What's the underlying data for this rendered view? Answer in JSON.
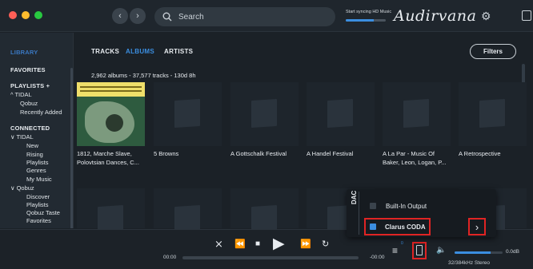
{
  "header": {
    "search_placeholder": "Search",
    "sync_label": "Start syncing HD Music",
    "sync_progress": 0.7,
    "logo": "Audirvana",
    "traffic_colors": [
      "#fe5f57",
      "#febc2e",
      "#28c840"
    ]
  },
  "sidebar": {
    "library": "LIBRARY",
    "favorites": "FAVORITES",
    "playlists": "PLAYLISTS  +",
    "playlist_items": [
      "^ TIDAL",
      "Qobuz",
      "Recently Added"
    ],
    "connected": "CONNECTED",
    "tidal_group": "∨ TIDAL",
    "tidal_items": [
      "New",
      "Rising",
      "Playlists",
      "Genres",
      "My Music"
    ],
    "qobuz_group": "∨ Qobuz",
    "qobuz_items": [
      "Discover",
      "Playlists",
      "Qobuz Taste",
      "Favorites"
    ]
  },
  "main": {
    "tabs": [
      "TRACKS",
      "ALBUMS",
      "ARTISTS"
    ],
    "active_tab": "ALBUMS",
    "filters_label": "Filters",
    "summary": "2,962 albums - 37,577 tracks - 130d 8h",
    "albums_row1": [
      {
        "title": "1812, Marche Slave,",
        "subtitle": "Polovtsian Dances, C..."
      },
      {
        "title": "5 Browns",
        "subtitle": ""
      },
      {
        "title": "A Gottschalk Festival",
        "subtitle": ""
      },
      {
        "title": "A Handel Festival",
        "subtitle": ""
      },
      {
        "title": "A La Par - Music Of",
        "subtitle": "Baker, Leon, Logan, P..."
      },
      {
        "title": "A Retrospective",
        "subtitle": ""
      }
    ]
  },
  "player": {
    "time_elapsed": "00:00",
    "time_remaining": "-00:00",
    "volume_level": "0.0dB",
    "volume_fraction": 0.75,
    "format": "32/384kHz Stereo",
    "queue_badge": "0"
  },
  "dac_menu": {
    "label": "DAC",
    "options": [
      "Built-In Output",
      "Clarus CODA"
    ],
    "selected": "Clarus CODA"
  }
}
